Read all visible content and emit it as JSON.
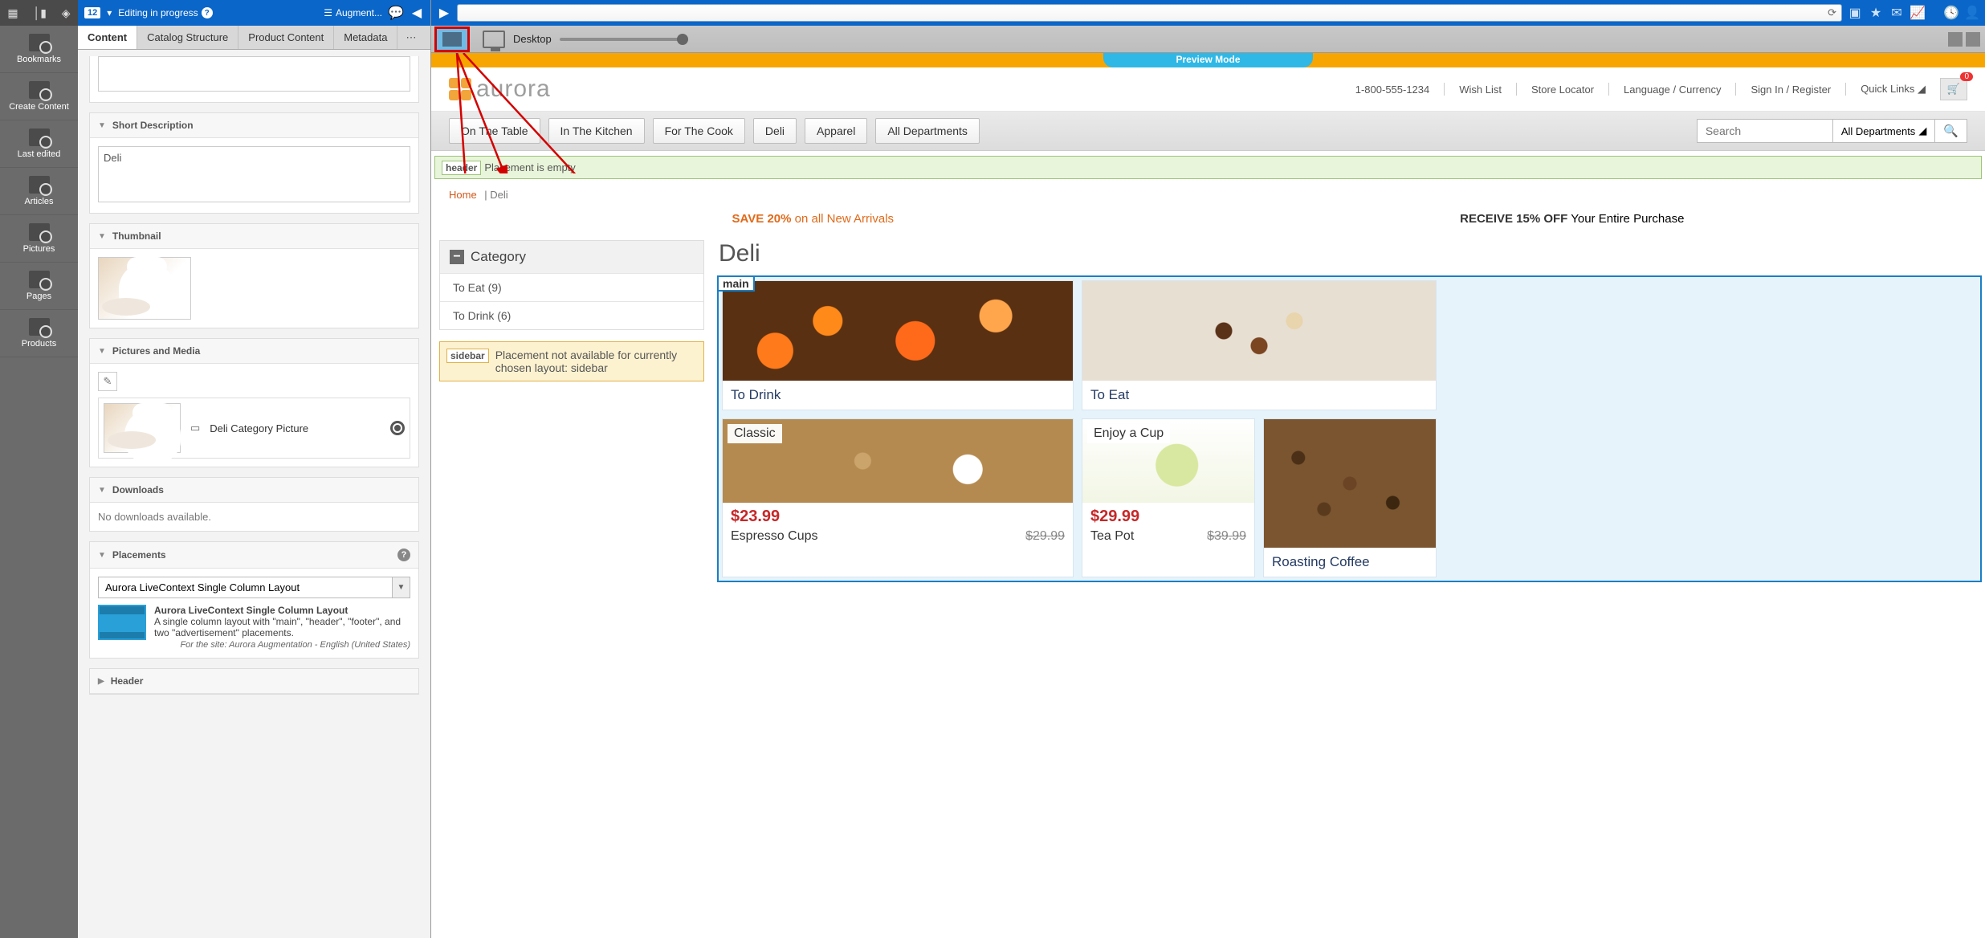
{
  "rail": {
    "items": [
      "Bookmarks",
      "Create Content",
      "Last edited",
      "Articles",
      "Pictures",
      "Pages",
      "Products"
    ]
  },
  "editorTop": {
    "badge": "12",
    "status": "Editing in progress",
    "augment": "Augment..."
  },
  "tabs": [
    "Content",
    "Catalog Structure",
    "Product Content",
    "Metadata"
  ],
  "sections": {
    "shortDesc": {
      "title": "Short Description",
      "value": "Deli"
    },
    "thumbnail": {
      "title": "Thumbnail"
    },
    "picsMedia": {
      "title": "Pictures and Media",
      "item": "Deli Category Picture"
    },
    "downloads": {
      "title": "Downloads",
      "msg": "No downloads available."
    },
    "placements": {
      "title": "Placements",
      "select": "Aurora LiveContext Single Column Layout",
      "layoutName": "Aurora LiveContext Single Column Layout",
      "layoutDesc": "A single column layout with \"main\", \"header\", \"footer\", and two \"advertisement\" placements.",
      "layoutSite": "For the site: Aurora Augmentation - English (United States)"
    },
    "header": {
      "title": "Header"
    }
  },
  "viewport": {
    "label": "Desktop"
  },
  "modeLabel": "Preview Mode",
  "site": {
    "logo": "aurora",
    "phone": "1-800-555-1234",
    "links": [
      "Wish List",
      "Store Locator",
      "Language / Currency",
      "Sign In / Register",
      "Quick Links"
    ],
    "cartCount": "0"
  },
  "nav": {
    "items": [
      "On The Table",
      "In The Kitchen",
      "For The Cook",
      "Deli",
      "Apparel",
      "All Departments"
    ],
    "searchPlaceholder": "Search",
    "searchCat": "All Departments"
  },
  "placeholders": {
    "headerLabel": "header",
    "headerMsg": "Placement is empty",
    "sidebarLabel": "sidebar",
    "sidebarMsg": "Placement not available for currently chosen layout: sidebar",
    "mainLabel": "main"
  },
  "crumbs": {
    "home": "Home",
    "current": "Deli"
  },
  "promo": {
    "leftBold": "SAVE 20%",
    "leftRest": " on all New Arrivals",
    "rightBold": "RECEIVE 15% OFF",
    "rightRest": " Your Entire Purchase"
  },
  "category": {
    "title": "Category",
    "items": [
      "To Eat (9)",
      "To Drink (6)"
    ]
  },
  "pageTitle": "Deli",
  "cards": {
    "toDrink": "To Drink",
    "toEat": "To Eat",
    "roasting": "Roasting Coffee"
  },
  "products": {
    "espresso": {
      "tag": "Classic",
      "price": "$23.99",
      "name": "Espresso Cups",
      "old": "$29.99"
    },
    "teapot": {
      "tag": "Enjoy a Cup",
      "price": "$29.99",
      "name": "Tea Pot",
      "old": "$39.99"
    }
  }
}
